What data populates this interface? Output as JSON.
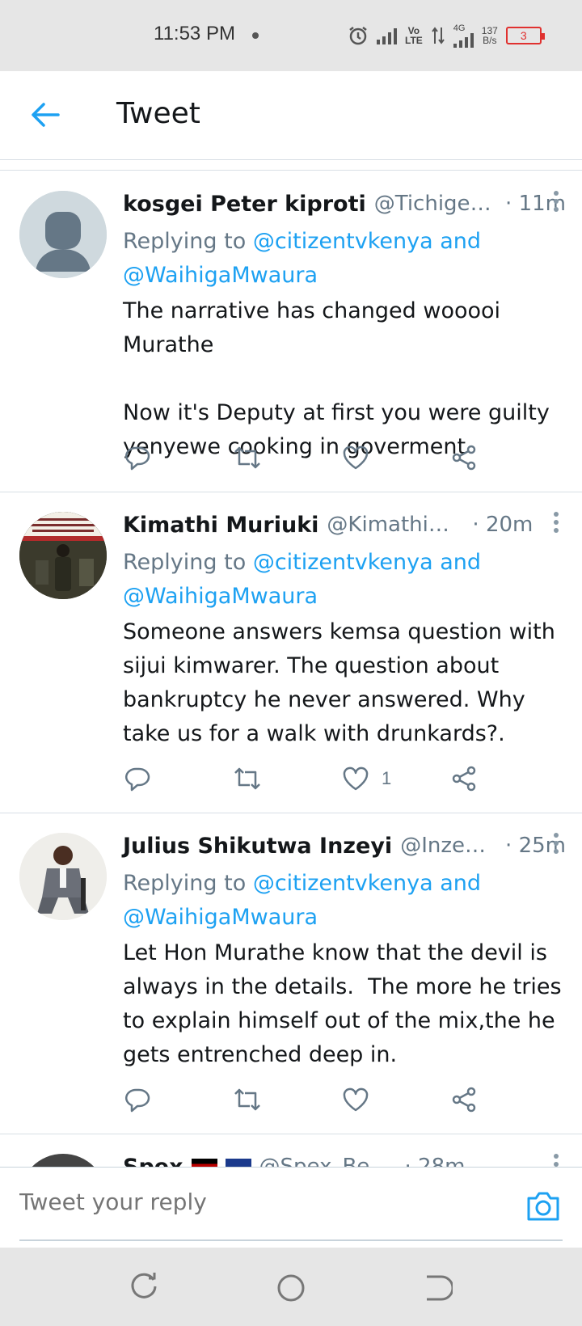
{
  "status_bar": {
    "time": "11:53 PM",
    "volte_label": "Vo\nLTE",
    "network_label": "4G",
    "speed_value": "137",
    "speed_unit": "B/s",
    "battery_level": "3"
  },
  "header": {
    "title": "Tweet",
    "accent_color": "#1da1f2"
  },
  "tweets": [
    {
      "name": "kosgei Peter kiproti",
      "handle": "@Tichigene...",
      "time": "· 11m",
      "replying_prefix": "Replying to",
      "replying_mention1": "@citizentvkenya",
      "replying_and": "and",
      "replying_mention2": "@WaihigaMwaura",
      "text": "The narrative has changed wooooi Murathe\n\nNow it's Deputy at first you were guilty yenyewe cooking in goverment",
      "likes": "",
      "avatar": "default-avatar"
    },
    {
      "name": "Kimathi Muriuki",
      "handle": "@KimathiMuriu...",
      "time": "· 20m",
      "replying_prefix": "Replying to",
      "replying_mention1": "@citizentvkenya",
      "replying_and": "and",
      "replying_mention2": "@WaihigaMwaura",
      "text": "Someone answers kemsa question with sijui kimwarer. The question about bankruptcy he never answered. Why take us for a walk with drunkards?.",
      "likes": "1",
      "avatar": "photo-avatar"
    },
    {
      "name": "Julius Shikutwa Inzeyi",
      "handle": "@InzeyiJ...",
      "time": "· 25m",
      "replying_prefix": "Replying to",
      "replying_mention1": "@citizentvkenya",
      "replying_and": "and",
      "replying_mention2": "@WaihigaMwaura",
      "text": "Let Hon Murathe know that the devil is always in the details.  The more he tries to explain himself out of the mix,the he gets entrenched deep in.",
      "likes": "",
      "avatar": "photo-avatar"
    },
    {
      "name": "Spex",
      "handle": "@Spex_Bey...",
      "time": "· 28m"
    }
  ],
  "compose": {
    "placeholder": "Tweet your reply"
  },
  "icons": {
    "reply": "reply-icon",
    "retweet": "retweet-icon",
    "like": "heart-icon",
    "share": "share-icon",
    "camera": "camera-icon"
  }
}
